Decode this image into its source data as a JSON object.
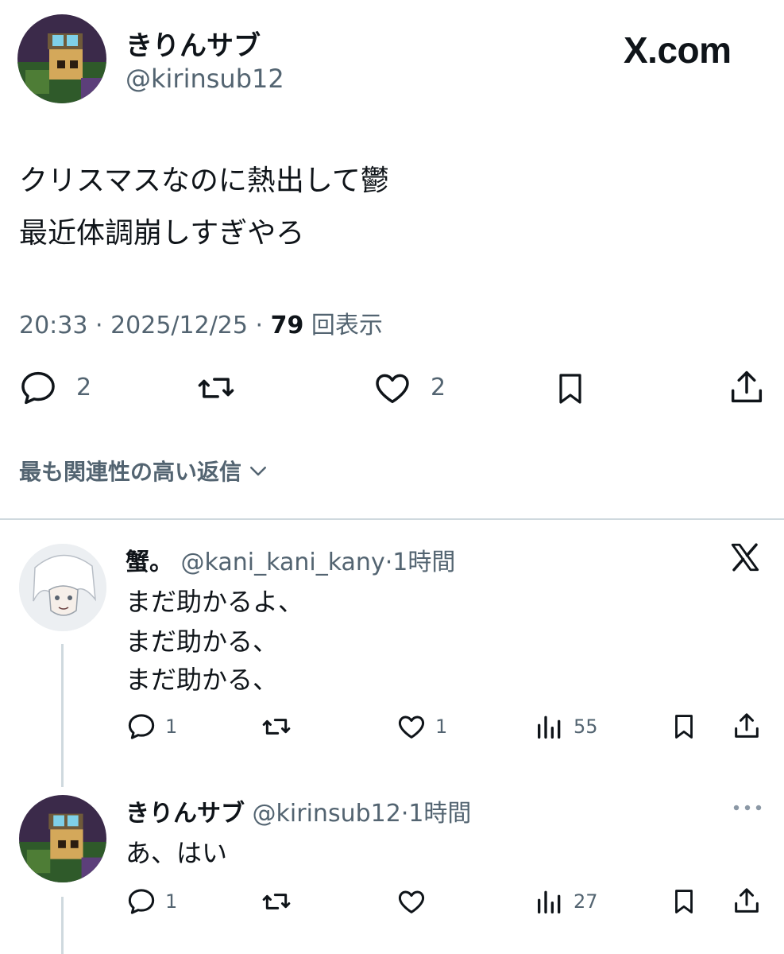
{
  "tweet": {
    "author_name": "きりんサブ",
    "author_handle": "@kirinsub12",
    "brand": "X.com",
    "text_line1": "クリスマスなのに熱出して鬱",
    "text_line2": "最近体調崩しすぎやろ",
    "time": "20:33 · 2025/12/25 · ",
    "views": "79",
    "views_label": " 回表示",
    "reply_count": "2",
    "like_count": "2"
  },
  "sort_label": "最も関連性の高い返信",
  "replies": [
    {
      "name": "蟹。",
      "handle": "@kani_kani_kany",
      "time": "·1時間",
      "lines": [
        "まだ助かるよ、",
        "まだ助かる、",
        "まだ助かる、"
      ],
      "reply_count": "1",
      "like_count": "1",
      "view_count": "55"
    },
    {
      "name": "きりんサブ",
      "handle": "@kirinsub12",
      "time": "·1時間",
      "lines": [
        "あ、はい"
      ],
      "reply_count": "1",
      "view_count": "27"
    }
  ],
  "colors": {
    "text": "#0f1419",
    "muted": "#536471",
    "divider": "#cfd9de",
    "thread_line": "#cfd9de"
  },
  "icons": [
    "x-logo-icon",
    "reply-icon",
    "retweet-icon",
    "like-icon",
    "bookmark-icon",
    "share-icon",
    "views-icon",
    "more-icon",
    "chevron-down-icon"
  ]
}
